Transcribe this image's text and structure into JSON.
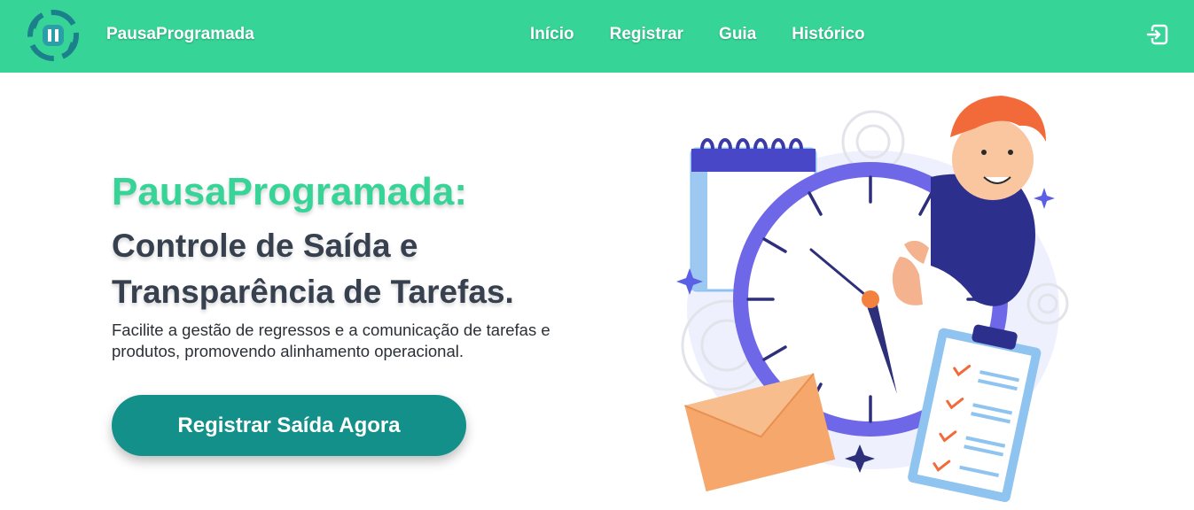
{
  "header": {
    "brand": "PausaProgramada",
    "nav": [
      "Início",
      "Registrar",
      "Guia",
      "Histórico"
    ],
    "logo_icon": "pause-cycle-icon",
    "logout_icon": "logout-icon"
  },
  "hero": {
    "title_green": "PausaProgramada:",
    "title_line1": "Controle de Saída e",
    "title_line2": "Transparência de Tarefas.",
    "description": "Facilite a gestão de regressos e a comunicação de tarefas e produtos, promovendo alinhamento operacional.",
    "cta": "Registrar Saída Agora"
  },
  "colors": {
    "header_bg": "#37d498",
    "accent_green": "#37d498",
    "cta_bg": "#14908a",
    "title_dark": "#37404f",
    "clock_purple": "#5b5fe6",
    "envelope": "#f5a76c"
  }
}
